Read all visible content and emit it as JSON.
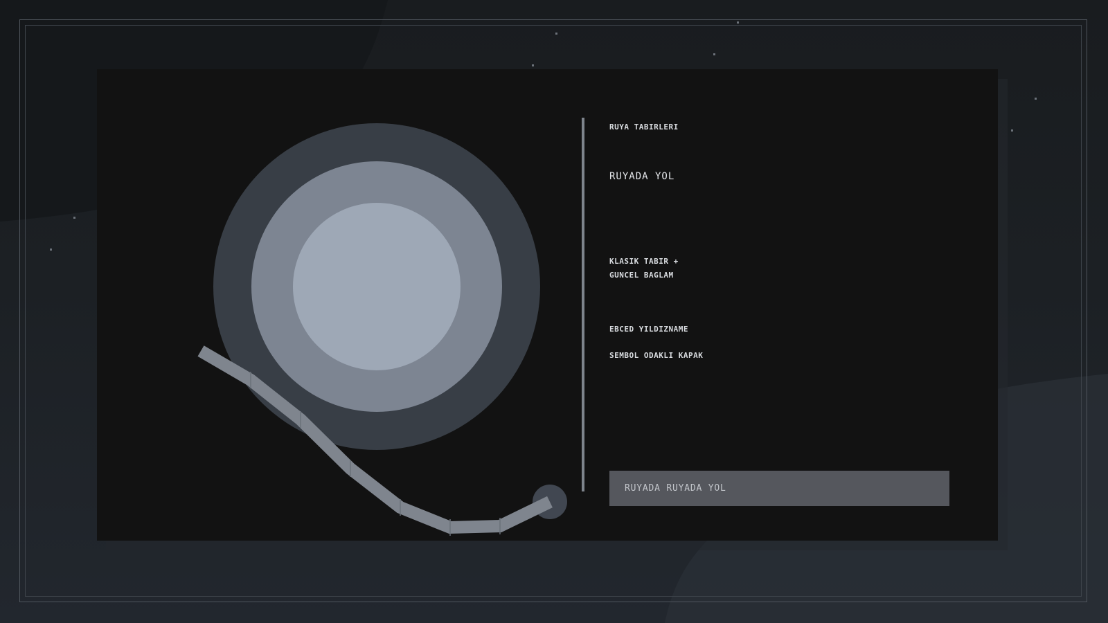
{
  "card": {
    "kicker": "RUYA TABIRLERI",
    "title": "RUYADA YOL",
    "subtitle_line1": "KLASIK TABIR +",
    "subtitle_line2": "GUNCEL BAGLAM",
    "tag1": "EBCED YILDIZNAME",
    "tag2": "SEMBOL ODAKLI KAPAK",
    "footer_label": "RUYADA RUYADA YOL"
  },
  "colors": {
    "background": "#1d2126",
    "card": "#121212",
    "ring_outer": "#383e46",
    "ring_middle": "#7d8592",
    "ring_inner": "#9ea8b6",
    "path": "#7f858e",
    "divider": "#7e848c",
    "label_bg": "#55575d"
  },
  "icons": {
    "moon": "concentric-circles-moon",
    "road": "winding-road-path"
  }
}
